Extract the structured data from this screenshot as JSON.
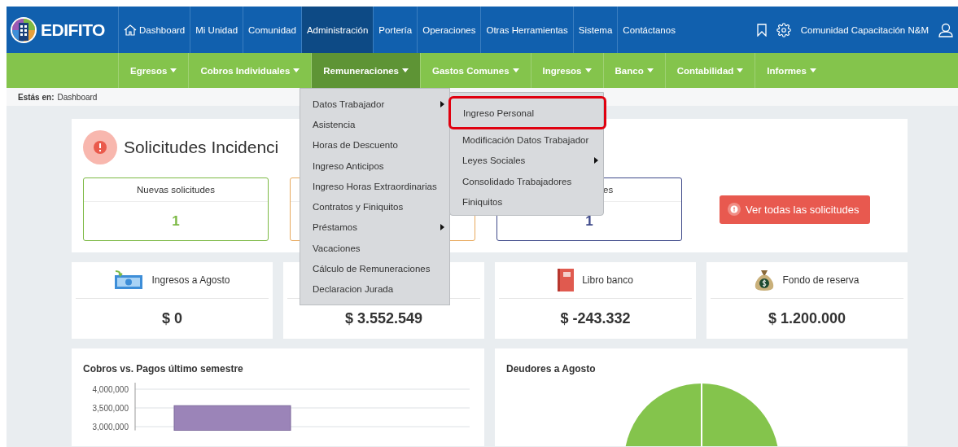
{
  "logo": {
    "text": "EDIFITO"
  },
  "top_nav": [
    {
      "label": "Dashboard",
      "kind": "home",
      "selected": false
    },
    {
      "label": "Mi Unidad",
      "kind": "plain",
      "selected": false
    },
    {
      "label": "Comunidad",
      "kind": "plain",
      "selected": false
    },
    {
      "label": "Administración",
      "kind": "plain",
      "selected": true
    },
    {
      "label": "Portería",
      "kind": "plain",
      "selected": false
    },
    {
      "label": "Operaciones",
      "kind": "plain",
      "selected": false
    },
    {
      "label": "Otras Herramientas",
      "kind": "plain",
      "selected": false
    },
    {
      "label": "Sistema",
      "kind": "plain",
      "selected": false
    },
    {
      "label": "Contáctanos",
      "kind": "plain",
      "selected": false
    }
  ],
  "user": {
    "name": "Comunidad Capacitación N&M"
  },
  "sub_nav": [
    {
      "label": "Egresos",
      "selected": false
    },
    {
      "label": "Cobros Individuales",
      "selected": false
    },
    {
      "label": "Remuneraciones",
      "selected": true
    },
    {
      "label": "Gastos Comunes",
      "selected": false
    },
    {
      "label": "Ingresos",
      "selected": false
    },
    {
      "label": "Banco",
      "selected": false
    },
    {
      "label": "Contabilidad",
      "selected": false
    },
    {
      "label": "Informes",
      "selected": false
    }
  ],
  "breadcrumb": {
    "label": "Estás en:",
    "value": "Dashboard"
  },
  "incidents": {
    "title": "Solicitudes Incidenci",
    "button": "Ver todas las solicitudes",
    "cards": [
      {
        "label": "Nuevas solicitudes",
        "value": "1",
        "color": "#7cb944"
      },
      {
        "color": "#e8a95c"
      },
      {
        "label": "es",
        "value": "1",
        "color": "#3f4a8a"
      }
    ]
  },
  "stats": [
    {
      "kind": "income",
      "label": "Ingresos a Agosto",
      "value": "$ 0"
    },
    {
      "value": "$ 3.552.549"
    },
    {
      "kind": "bank",
      "label": "Libro banco",
      "value": "$ -243.332"
    },
    {
      "kind": "reserve",
      "label": "Fondo de reserva",
      "value": "$ 1.200.000"
    }
  ],
  "menu": {
    "items": [
      {
        "label": "Datos Trabajador",
        "submenu": true
      },
      {
        "label": "Asistencia",
        "submenu": false
      },
      {
        "label": "Horas de Descuento",
        "submenu": false
      },
      {
        "label": "Ingreso Anticipos",
        "submenu": false
      },
      {
        "label": "Ingreso Horas Extraordinarias",
        "submenu": false
      },
      {
        "label": "Contratos y Finiquitos",
        "submenu": false
      },
      {
        "label": "Préstamos",
        "submenu": true
      },
      {
        "label": "Vacaciones",
        "submenu": false
      },
      {
        "label": "Cálculo de Remuneraciones",
        "submenu": false
      },
      {
        "label": "Declaracion Jurada",
        "submenu": false
      }
    ],
    "submenu": [
      {
        "label": "Ingreso Personal",
        "submenu": false,
        "highlighted": true
      },
      {
        "label": "Modificación Datos Trabajador",
        "submenu": false,
        "highlighted": false
      },
      {
        "label": "Leyes Sociales",
        "submenu": true,
        "highlighted": false
      },
      {
        "label": "Consolidado Trabajadores",
        "submenu": false,
        "highlighted": false
      },
      {
        "label": "Finiquitos",
        "submenu": false,
        "highlighted": false
      }
    ]
  },
  "charts": [
    {
      "title": "Cobros vs. Pagos último semestre",
      "chart_data": {
        "type": "bar",
        "series": [
          {
            "color": "#9b84b8",
            "values": [
              3560000
            ]
          }
        ],
        "ylim": [
          2900000,
          4000000
        ],
        "yticks": [
          {
            "value": 3000000,
            "label": "3,000,000"
          },
          {
            "value": 3500000,
            "label": "3,500,000"
          },
          {
            "value": 4000000,
            "label": "4,000,000"
          }
        ]
      }
    },
    {
      "title": "Deudores a Agosto"
    }
  ]
}
